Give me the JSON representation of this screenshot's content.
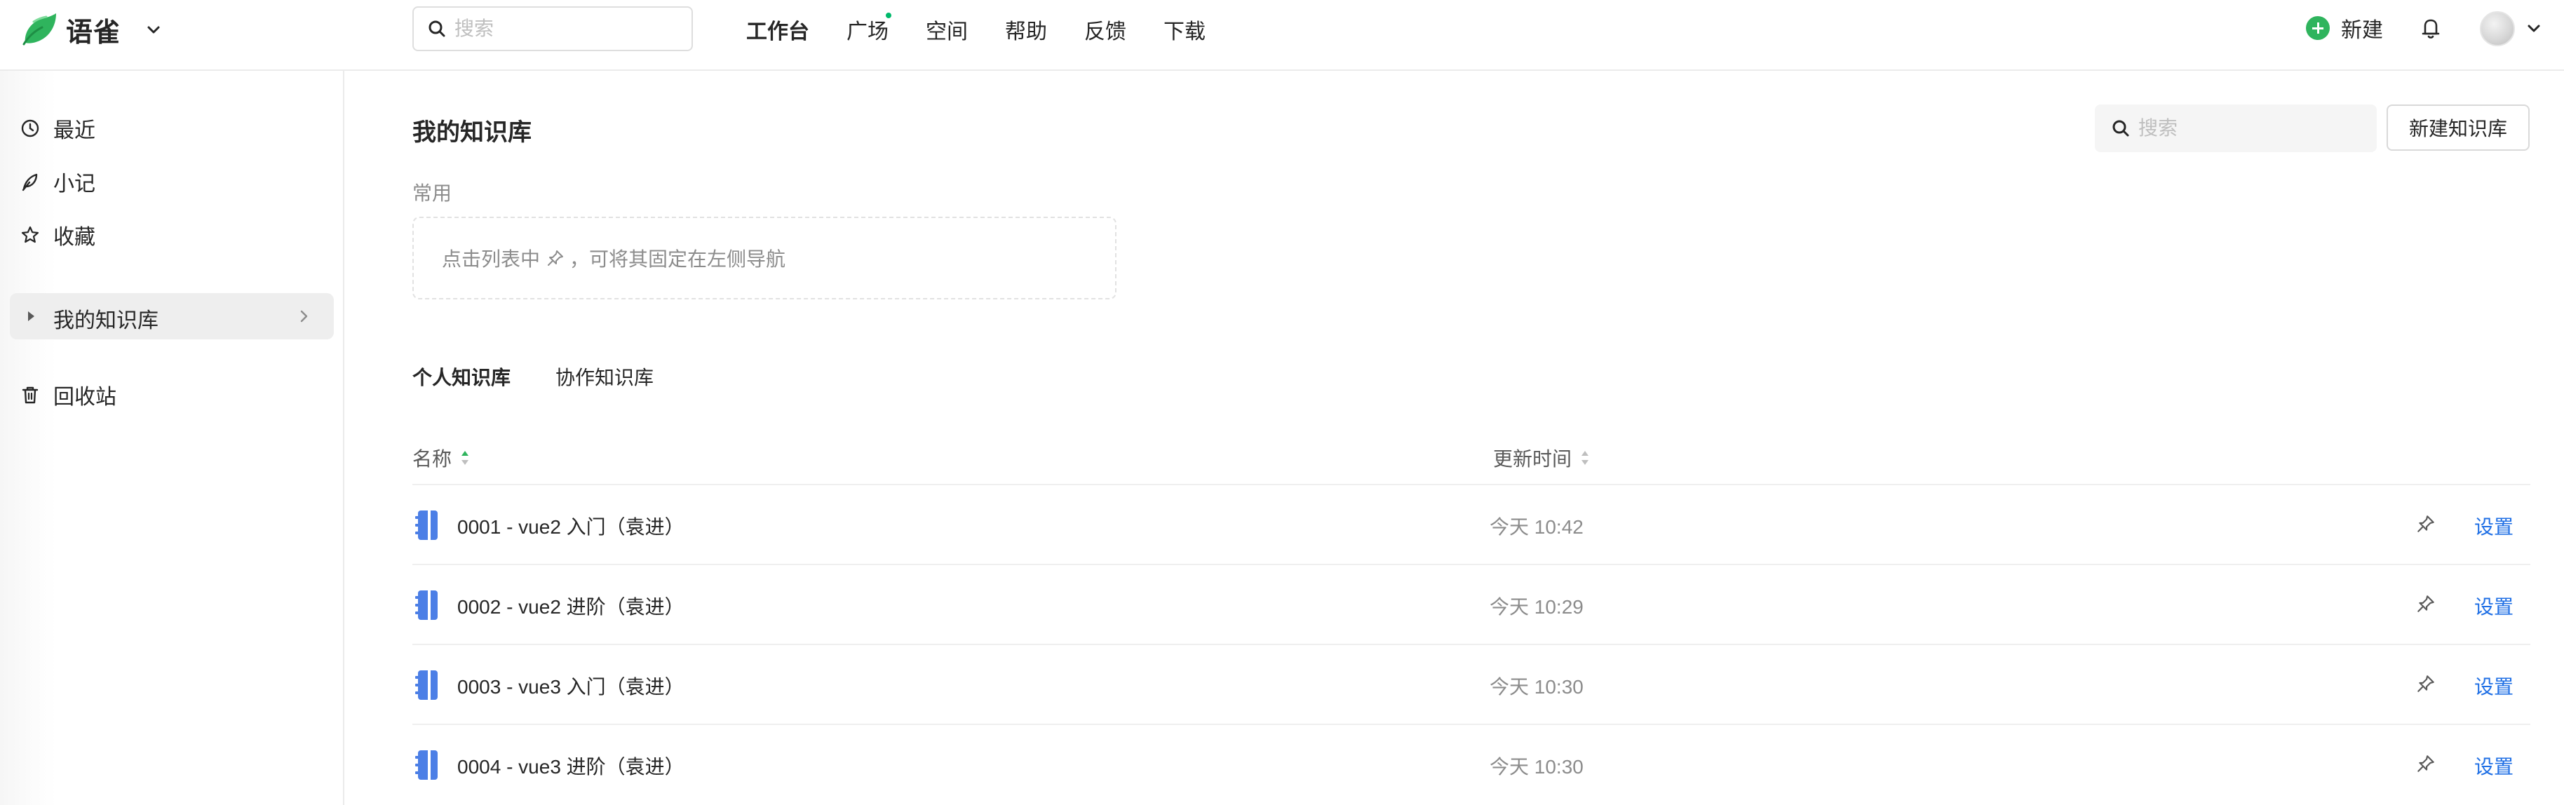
{
  "header": {
    "app_name": "语雀",
    "search_placeholder": "搜索",
    "nav": [
      "工作台",
      "广场",
      "空间",
      "帮助",
      "反馈",
      "下载"
    ],
    "nav_active_index": 0,
    "nav_dot_index": 1,
    "new_label": "新建"
  },
  "sidebar": {
    "items": [
      "最近",
      "小记",
      "收藏"
    ],
    "knowledge_base_label": "我的知识库",
    "trash_label": "回收站"
  },
  "main": {
    "title": "我的知识库",
    "search_placeholder": "搜索",
    "new_kb_label": "新建知识库",
    "common_label": "常用",
    "pin_hint_before": "点击列表中",
    "pin_hint_after": "，可将其固定在左侧导航",
    "tabs": [
      "个人知识库",
      "协作知识库"
    ],
    "active_tab_index": 0,
    "columns": {
      "name": "名称",
      "updated": "更新时间"
    },
    "rows": [
      {
        "name": "0001 - vue2 入门（袁进）",
        "time": "今天 10:42",
        "action": "设置"
      },
      {
        "name": "0002 - vue2 进阶（袁进）",
        "time": "今天 10:29",
        "action": "设置"
      },
      {
        "name": "0003 - vue3 入门（袁进）",
        "time": "今天 10:30",
        "action": "设置"
      },
      {
        "name": "0004 - vue3 进阶（袁进）",
        "time": "今天 10:30",
        "action": "设置"
      }
    ]
  },
  "colors": {
    "brand_green": "#2fb45d",
    "link_blue": "#1f6fe5",
    "book_icon_blue": "#4c7fe6",
    "sort_active_green": "#2fb45d"
  },
  "icons": {
    "logo": "yuque-leaf-logo",
    "search": "search-icon",
    "bell": "bell-icon",
    "sidebar": [
      "clock-icon",
      "feather-icon",
      "star-icon",
      "trash-icon"
    ],
    "pin": "pin-icon",
    "book": "book-icon"
  }
}
